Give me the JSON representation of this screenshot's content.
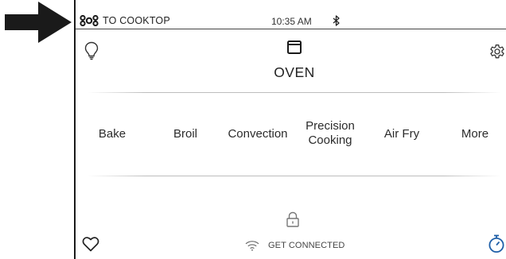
{
  "status_bar": {
    "cooktop_label": "TO COOKTOP",
    "time": "10:35 AM",
    "bluetooth_icon": "bluetooth-icon"
  },
  "header": {
    "title": "OVEN",
    "light_icon": "lightbulb-icon",
    "settings_icon": "gear-icon",
    "oven_icon": "oven-icon"
  },
  "modes": [
    {
      "label": "Bake"
    },
    {
      "label": "Broil"
    },
    {
      "label": "Convection"
    },
    {
      "line1": "Precision",
      "line2": "Cooking"
    },
    {
      "label": "Air Fry"
    },
    {
      "label": "More"
    }
  ],
  "footer": {
    "connect_label": "GET CONNECTED",
    "lock_icon": "lock-icon",
    "favorites_icon": "heart-icon",
    "timer_icon": "timer-icon"
  },
  "colors": {
    "text": "#2b2b2b",
    "divider": "#bdbdbd",
    "timer_accent": "#1f5fa8",
    "arrow": "#1a1a1a"
  }
}
